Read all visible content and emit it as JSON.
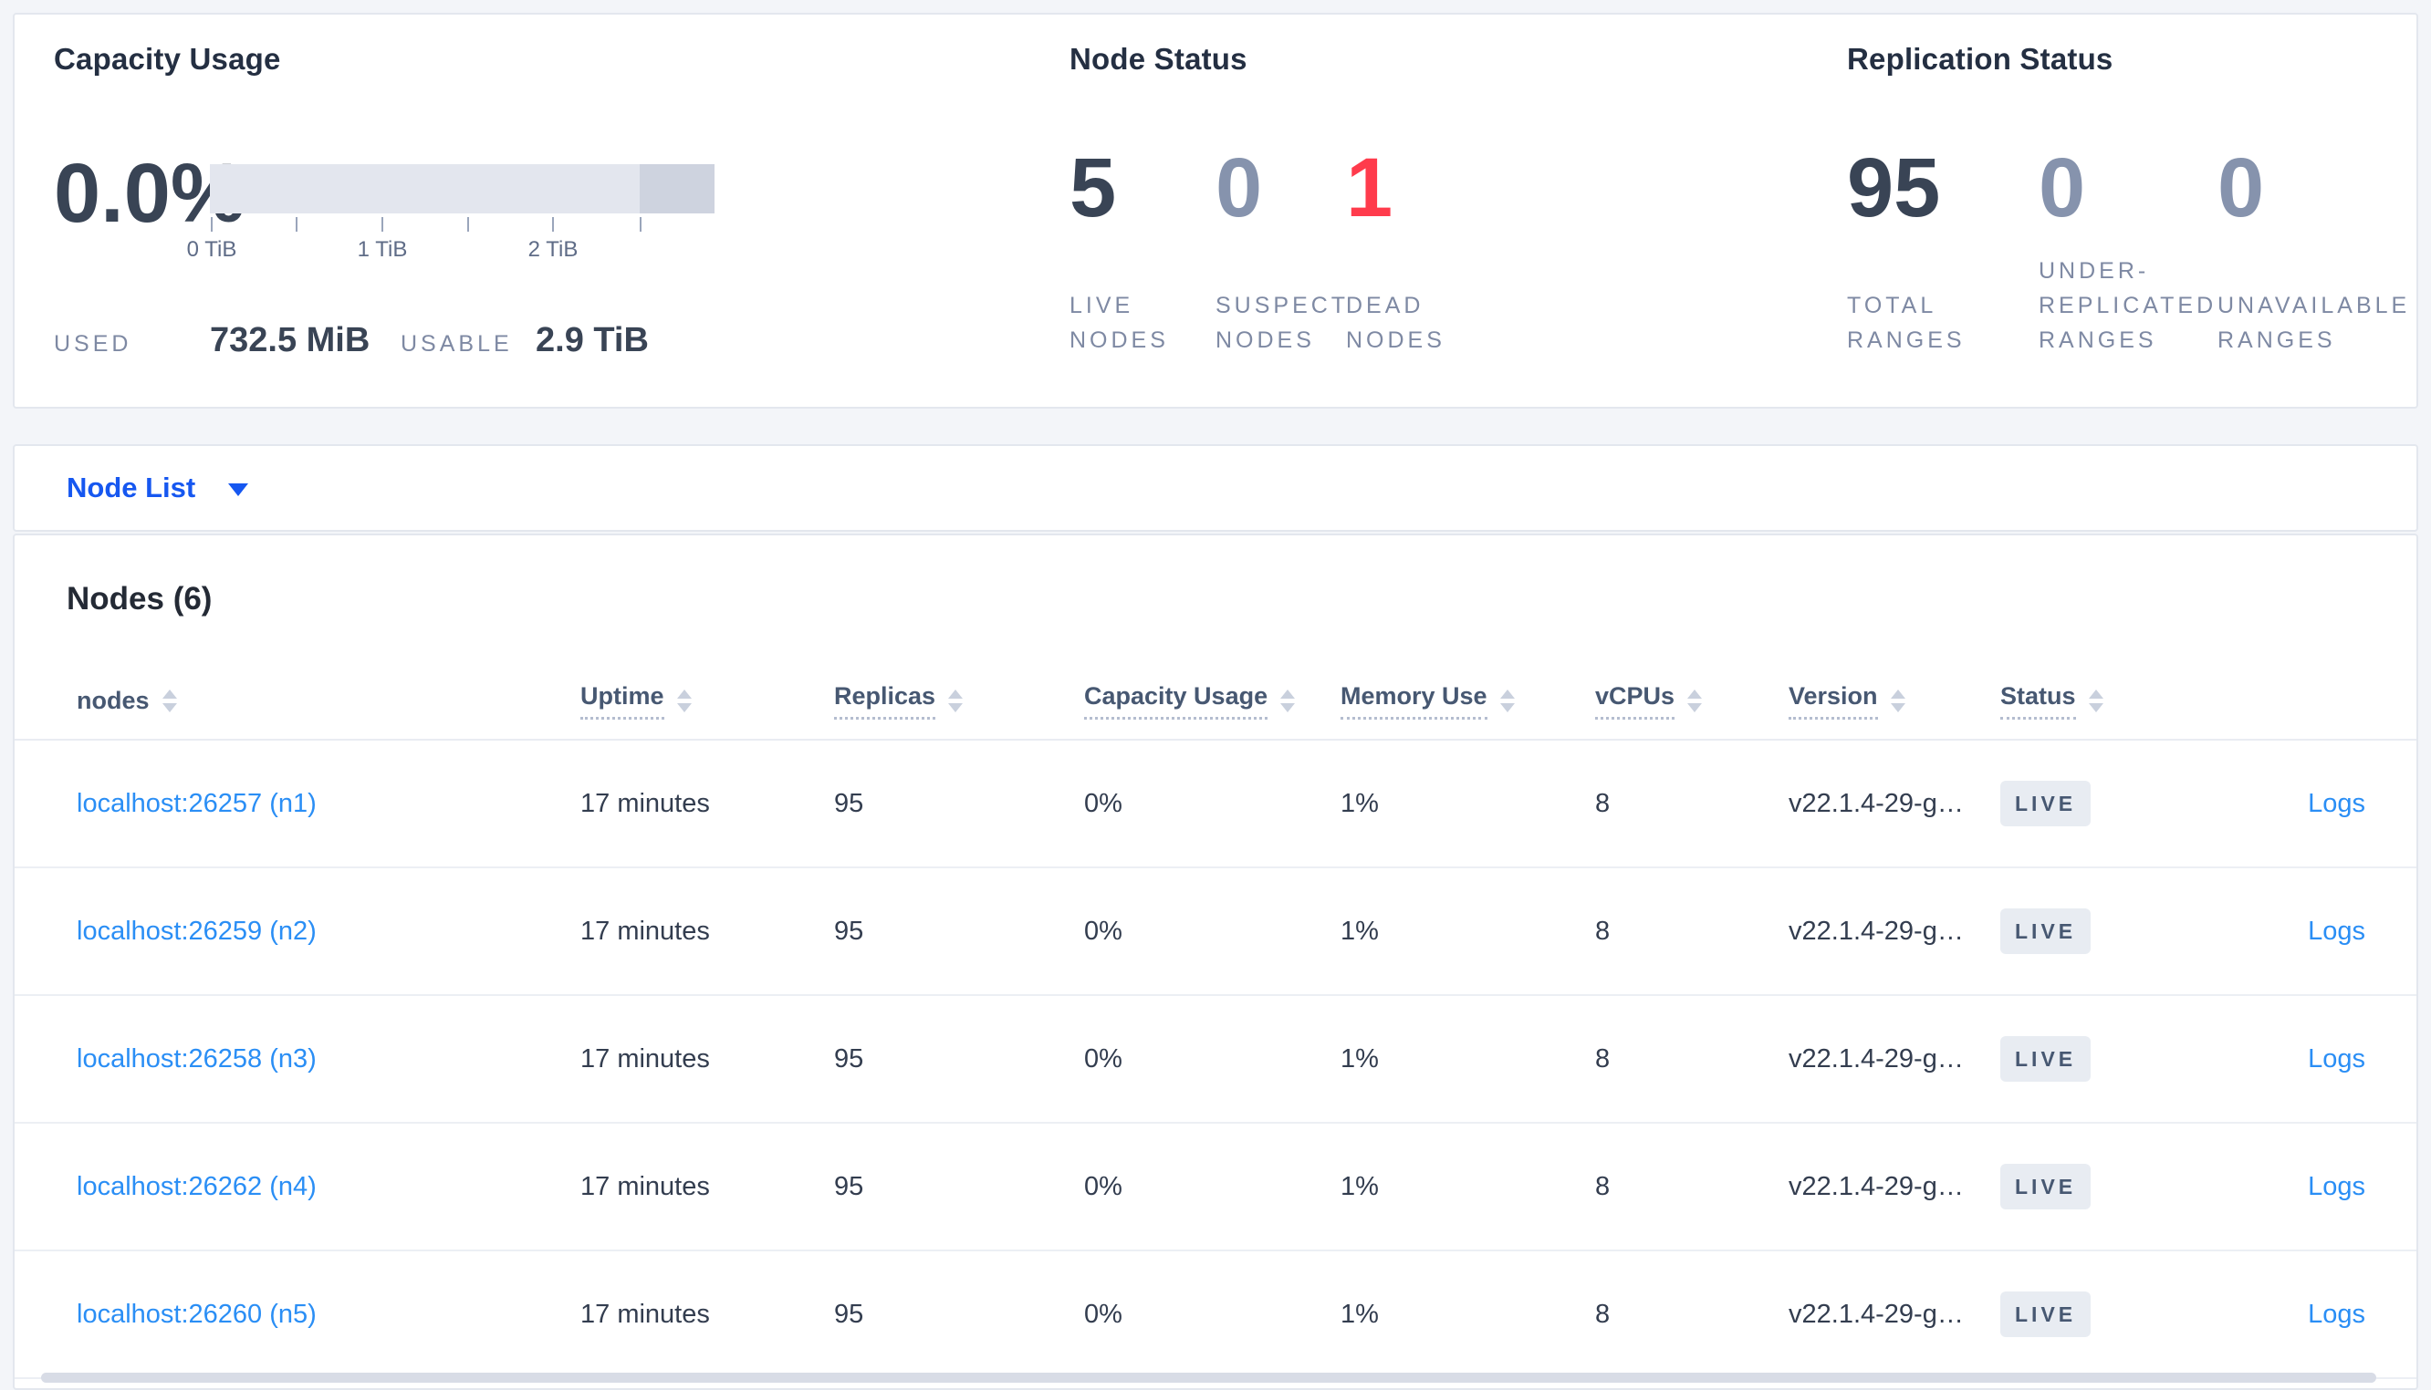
{
  "colors": {
    "accent_blue": "#1657f0",
    "link_blue": "#2a8ef5",
    "dark": "#394455",
    "muted": "#8693ad",
    "red": "#ff3b4c"
  },
  "summary": {
    "capacity": {
      "title": "Capacity Usage",
      "percent": "0.0%",
      "tick_labels": [
        "0 TiB",
        "1 TiB",
        "2 TiB"
      ],
      "used_label": "USED",
      "used_value": "732.5 MiB",
      "usable_label": "USABLE",
      "usable_value": "2.9 TiB"
    },
    "node_status": {
      "title": "Node Status",
      "stats": [
        {
          "value": "5",
          "label": "LIVE NODES",
          "color": "#394455"
        },
        {
          "value": "0",
          "label": "SUSPECT NODES",
          "color": "#8693ad"
        },
        {
          "value": "1",
          "label": "DEAD NODES",
          "color": "#ff3b4c"
        }
      ]
    },
    "replication_status": {
      "title": "Replication Status",
      "stats": [
        {
          "value": "95",
          "label": "TOTAL RANGES",
          "color": "#394455"
        },
        {
          "value": "0",
          "label": "UNDER-REPLICATED RANGES",
          "color": "#8693ad"
        },
        {
          "value": "0",
          "label": "UNAVAILABLE RANGES",
          "color": "#8693ad"
        }
      ]
    }
  },
  "view_selector": {
    "label": "Node List"
  },
  "table": {
    "title": "Nodes (6)",
    "logs_label": "Logs",
    "columns": [
      {
        "label": "nodes"
      },
      {
        "label": "Uptime"
      },
      {
        "label": "Replicas"
      },
      {
        "label": "Capacity Usage"
      },
      {
        "label": "Memory Use"
      },
      {
        "label": "vCPUs"
      },
      {
        "label": "Version"
      },
      {
        "label": "Status"
      }
    ],
    "rows": [
      {
        "node": "localhost:26257 (n1)",
        "uptime": "17 minutes",
        "replicas": "95",
        "capacity": "0%",
        "memory": "1%",
        "vcpus": "8",
        "version": "v22.1.4-29-g…",
        "status": "LIVE"
      },
      {
        "node": "localhost:26259 (n2)",
        "uptime": "17 minutes",
        "replicas": "95",
        "capacity": "0%",
        "memory": "1%",
        "vcpus": "8",
        "version": "v22.1.4-29-g…",
        "status": "LIVE"
      },
      {
        "node": "localhost:26258 (n3)",
        "uptime": "17 minutes",
        "replicas": "95",
        "capacity": "0%",
        "memory": "1%",
        "vcpus": "8",
        "version": "v22.1.4-29-g…",
        "status": "LIVE"
      },
      {
        "node": "localhost:26262 (n4)",
        "uptime": "17 minutes",
        "replicas": "95",
        "capacity": "0%",
        "memory": "1%",
        "vcpus": "8",
        "version": "v22.1.4-29-g…",
        "status": "LIVE"
      },
      {
        "node": "localhost:26260 (n5)",
        "uptime": "17 minutes",
        "replicas": "95",
        "capacity": "0%",
        "memory": "1%",
        "vcpus": "8",
        "version": "v22.1.4-29-g…",
        "status": "LIVE"
      }
    ]
  }
}
